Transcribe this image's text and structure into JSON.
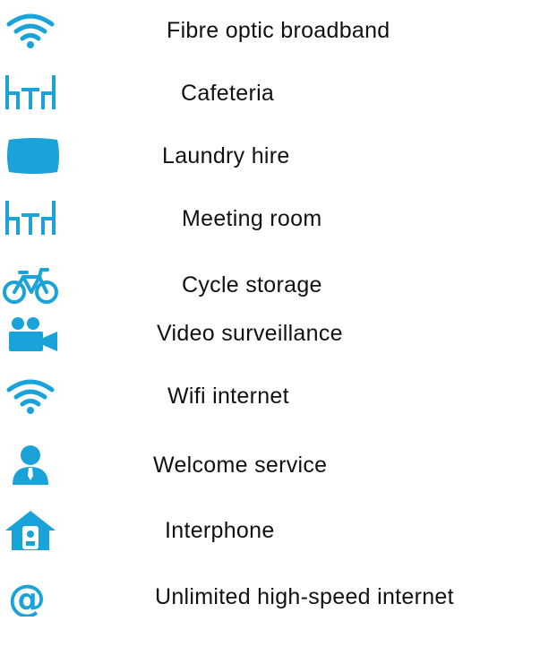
{
  "colors": {
    "icon": "#1aa3d9",
    "text": "#111111",
    "background": "#ffffff"
  },
  "amenities": [
    {
      "label": "Fibre optic broadband",
      "icon": "wifi-icon"
    },
    {
      "label": "Cafeteria",
      "icon": "table-chairs-icon"
    },
    {
      "label": "Laundry hire",
      "icon": "pillow-icon"
    },
    {
      "label": "Meeting room",
      "icon": "table-chairs-icon"
    },
    {
      "label": "Cycle storage",
      "icon": "bicycle-icon"
    },
    {
      "label": "Video surveillance",
      "icon": "video-camera-icon"
    },
    {
      "label": "Wifi internet",
      "icon": "wifi-icon"
    },
    {
      "label": "Welcome service",
      "icon": "receptionist-icon"
    },
    {
      "label": "Interphone",
      "icon": "house-intercom-icon"
    },
    {
      "label": "Unlimited high-speed internet",
      "icon": "at-sign-icon"
    }
  ]
}
